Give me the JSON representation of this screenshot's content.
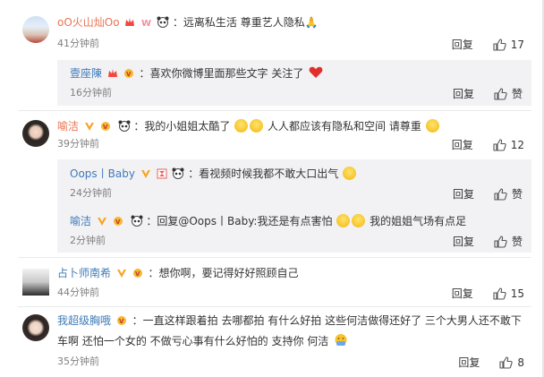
{
  "comments": [
    {
      "user": "oO火山灿Oo",
      "text": "：远离私生活 尊重艺人隐私🙏",
      "time": "41分钟前",
      "reply": "回复",
      "likes": "17",
      "replies": [
        {
          "user": "壹座陳",
          "text": "：喜欢你微博里面那些文字 关注了",
          "time": "16分钟前",
          "reply": "回复",
          "likes": "赞"
        }
      ]
    },
    {
      "user": "喻洁",
      "text_a": "：我的小姐姐太酷了",
      "text_b": "人人都应该有隐私和空间 请尊重",
      "time": "39分钟前",
      "reply": "回复",
      "likes": "12",
      "replies": [
        {
          "user": "Oops丨Baby",
          "text": "：看视频时候我都不敢大口出气",
          "time": "24分钟前",
          "reply": "回复",
          "likes": "赞"
        },
        {
          "user": "喻洁",
          "text_a": "：回复@Oops丨Baby:我还是有点害怕",
          "text_b": "我的姐姐气场有点足",
          "time": "2分钟前",
          "reply": "回复",
          "likes": "赞"
        }
      ]
    },
    {
      "user": "占卜师南希",
      "text": "：想你啊，要记得好好照顾自己",
      "time": "44分钟前",
      "reply": "回复",
      "likes": "15"
    },
    {
      "user": "我超级胸哦",
      "text_a": "：一直这样跟着拍 去哪都拍 有什么好拍 这些何洁做得还好了 三个大男人还不敢下",
      "text_b": "车啊 还怕一个女的 不做亏心事有什么好怕的 支持你 何洁",
      "time": "35分钟前",
      "reply": "回复",
      "likes": "8"
    }
  ],
  "colors": {
    "username": "#eb7350",
    "sub_username": "#3f7bb8",
    "subbg": "#f2f2f5",
    "time": "#808080"
  },
  "icons": [
    "thumbs-up-icon",
    "crown-icon",
    "vip-icon",
    "panda-icon",
    "laugh-emoji",
    "smile-emoji",
    "heart-emoji",
    "rubbing-emoji"
  ]
}
